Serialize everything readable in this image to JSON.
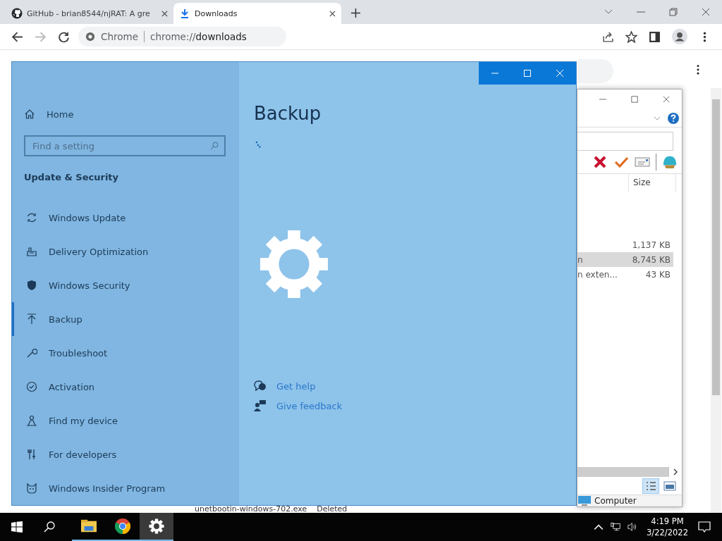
{
  "browser": {
    "tabs": [
      {
        "title": "GitHub - brian8544/njRAT: A gre",
        "selected": false
      },
      {
        "title": "Downloads",
        "selected": true
      }
    ],
    "address": {
      "site_label": "Chrome",
      "url_prefix": "chrome://",
      "url_host": "downloads"
    }
  },
  "downloads_page": {
    "partial_item": {
      "file": "unetbootin-windows-702.exe",
      "status": "Deleted"
    }
  },
  "file_window": {
    "column": "Size",
    "rows": [
      {
        "size": "1,137 KB",
        "selected": false
      },
      {
        "name": "n",
        "size": "8,745 KB",
        "selected": true
      },
      {
        "name": "n exten...",
        "size": "43 KB",
        "selected": false
      }
    ],
    "status": "Computer"
  },
  "settings": {
    "home": "Home",
    "search": {
      "placeholder": "Find a setting"
    },
    "section": "Update & Security",
    "items": [
      {
        "label": "Windows Update",
        "selected": false
      },
      {
        "label": "Delivery Optimization",
        "selected": false
      },
      {
        "label": "Windows Security",
        "selected": false
      },
      {
        "label": "Backup",
        "selected": true
      },
      {
        "label": "Troubleshoot",
        "selected": false
      },
      {
        "label": "Activation",
        "selected": false
      },
      {
        "label": "Find my device",
        "selected": false
      },
      {
        "label": "For developers",
        "selected": false
      },
      {
        "label": "Windows Insider Program",
        "selected": false
      }
    ],
    "page_title": "Backup",
    "links": [
      {
        "label": "Get help"
      },
      {
        "label": "Give feedback"
      }
    ]
  },
  "taskbar": {
    "apps": [
      {
        "selected": false
      },
      {
        "selected": false
      },
      {
        "selected": true
      }
    ],
    "time": "4:19 PM",
    "date": "3/22/2022"
  }
}
